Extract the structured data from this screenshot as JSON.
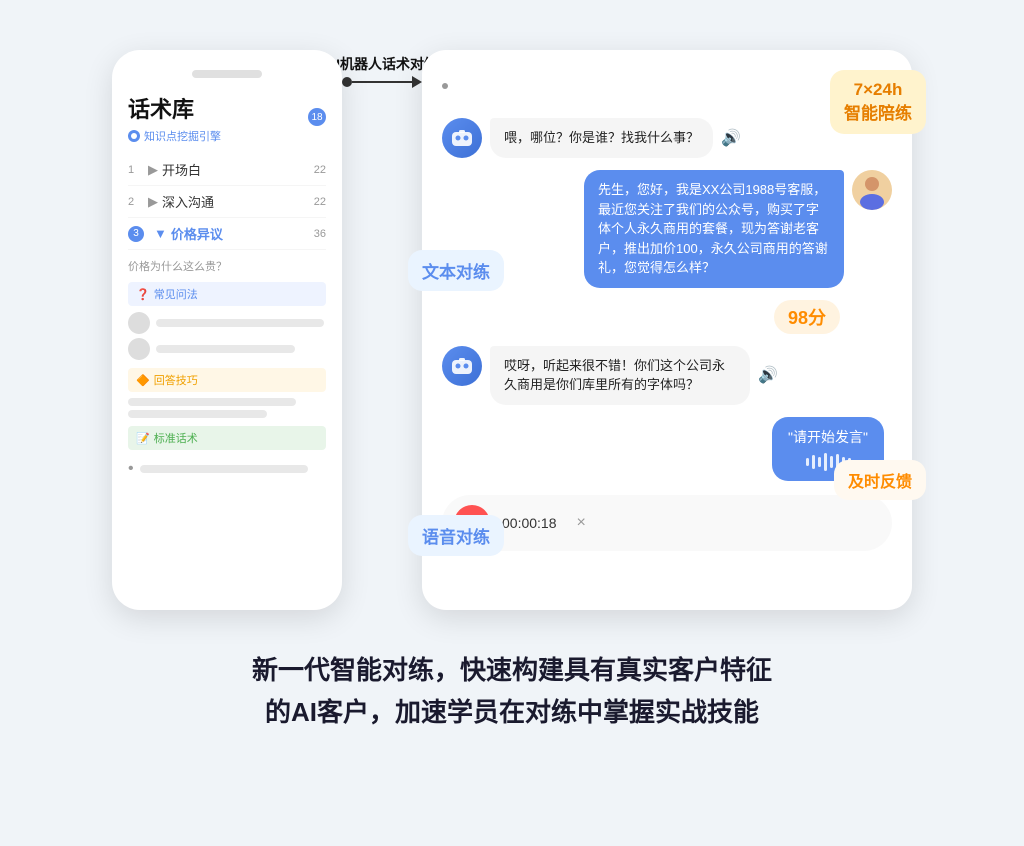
{
  "phone": {
    "title": "话术库",
    "subtitle": "知识点挖掘引擎",
    "badge": "18",
    "menu_items": [
      {
        "num": "1",
        "label": "开场白",
        "count": "22",
        "active": false
      },
      {
        "num": "2",
        "label": "深入沟通",
        "count": "22",
        "active": false
      },
      {
        "num": "3",
        "label": "价格异议",
        "count": "36",
        "active": true
      }
    ],
    "question": "价格为什么这么贵？",
    "sections": [
      {
        "type": "faq",
        "icon": "❓",
        "label": "常见问法"
      },
      {
        "type": "tips",
        "icon": "🔶",
        "label": "回答技巧"
      },
      {
        "type": "standard",
        "icon": "📝",
        "label": "标准话术"
      }
    ]
  },
  "connector": {
    "label": "AI机器人话术对练"
  },
  "chat": {
    "messages": [
      {
        "side": "left",
        "text": "喂，哪位？你是谁？找我什么事？",
        "has_sound": true
      },
      {
        "side": "right",
        "text": "先生，您好，我是XX公司1988号客服，最近您关注了我们的公众号，购买了字体个人永久商用的套餐，现为答谢老客户，推出加价100，永久公司商用的答谢礼，您觉得怎么样？",
        "has_sound": false
      },
      {
        "side": "score",
        "text": "98分"
      },
      {
        "side": "left",
        "text": "哎呀，听起来很不错！你们这个公司永久商用是你们库里所有的字体吗？",
        "has_sound": true
      }
    ],
    "text_drill_label": "文本对练",
    "voice_drill_label": "语音对练",
    "voice_bubble_text": "\"请开始发言\"",
    "voice_timer": "00:00:18",
    "voice_close": "×",
    "float_247": "7×24h\n智能陪练",
    "float_feedback": "及时反馈"
  },
  "bottom_text_line1": "新一代智能对练，快速构建具有真实客户特征",
  "bottom_text_line2": "的AI客户，加速学员在对练中掌握实战技能"
}
